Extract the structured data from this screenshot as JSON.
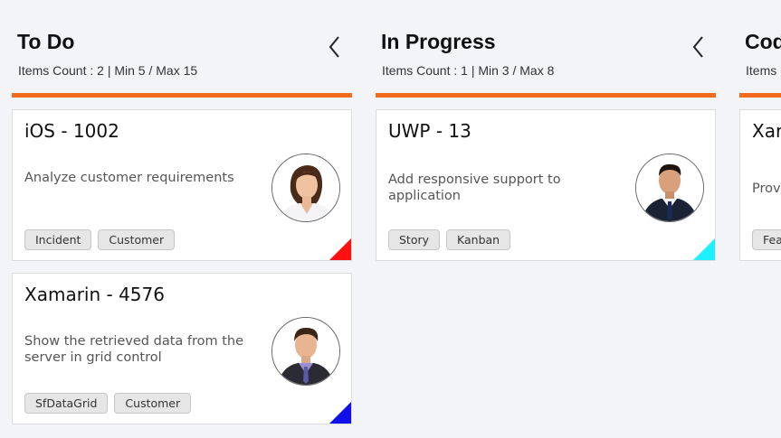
{
  "colors": {
    "accent": "#f26b1d",
    "background": "#f3f4f8",
    "indicator_red": "#ff1010",
    "indicator_cyan": "#1ef0ff",
    "indicator_blue": "#1010e8"
  },
  "columns": [
    {
      "title": "To Do",
      "count_text": "Items Count : 2 | Min 5 / Max 15",
      "cards": [
        {
          "title": "iOS - 1002",
          "description": "Analyze customer requirements",
          "tags": [
            "Incident",
            "Customer"
          ],
          "avatar": "woman-avatar",
          "indicator_color": "#ff1010"
        },
        {
          "title": "Xamarin - 4576",
          "description": "Show the retrieved data from the server in grid control",
          "tags": [
            "SfDataGrid",
            "Customer"
          ],
          "avatar": "man-avatar",
          "indicator_color": "#1010e8"
        }
      ]
    },
    {
      "title": "In Progress",
      "count_text": "Items Count : 1 | Min 3 / Max 8",
      "cards": [
        {
          "title": "UWP - 13",
          "description": "Add responsive support to application",
          "tags": [
            "Story",
            "Kanban"
          ],
          "avatar": "man-suit-avatar",
          "indicator_color": "#1ef0ff"
        }
      ]
    },
    {
      "title": "Cod",
      "count_text": "Items",
      "cards": [
        {
          "title": "Xar",
          "description": "Prov",
          "tags": [
            "Fea"
          ]
        }
      ]
    }
  ]
}
